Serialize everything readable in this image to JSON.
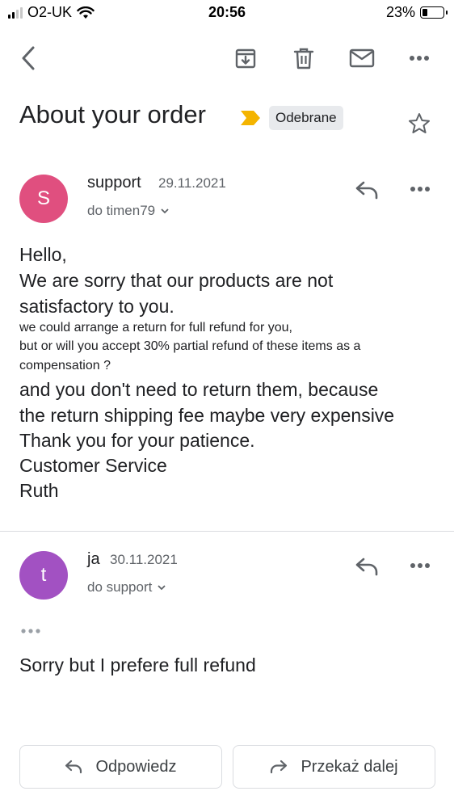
{
  "status_bar": {
    "carrier": "O2-UK",
    "time": "20:56",
    "battery": "23%"
  },
  "message": {
    "subject": "About your order",
    "label": "Odebrane",
    "star_icon": "star-outline-icon"
  },
  "thread": [
    {
      "avatar_letter": "S",
      "avatar_color": "#e04f7f",
      "sender": "support",
      "date": "29.11.2021",
      "recipient": "do timen79",
      "body_lines": [
        "Hello,",
        "We are sorry that our products are not",
        "satisfactory to you.",
        "we could arrange a return for full refund for you,",
        "but or will you accept 30% partial refund of these items as a",
        "compensation ?",
        "and you don't need to return them, because",
        "the return shipping fee maybe very expensive",
        "Thank you for your patience.",
        "Customer Service",
        "Ruth"
      ]
    },
    {
      "avatar_letter": "t",
      "avatar_color": "#a251c2",
      "sender": "ja",
      "date": "30.11.2021",
      "recipient": "do support",
      "body": "Sorry but I prefere full refund"
    }
  ],
  "actions": {
    "reply": "Odpowiedz",
    "forward": "Przekaż dalej"
  }
}
